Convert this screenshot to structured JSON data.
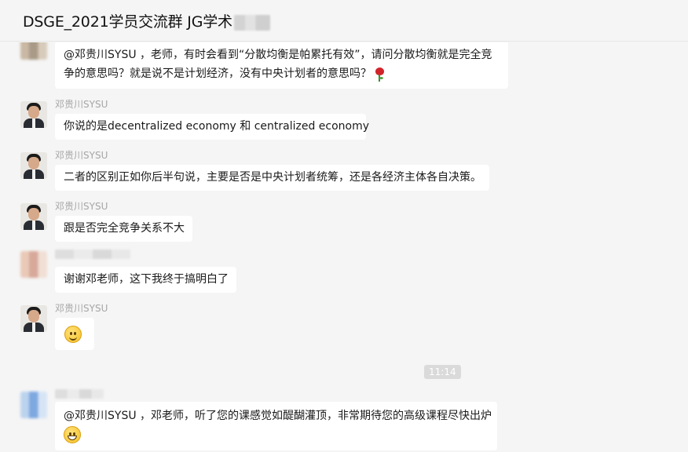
{
  "window": {
    "title": "DSGE_2021学员交流群 JG学术"
  },
  "messages": [
    {
      "sender": "",
      "lines": [
        "@邓贵川SYSU ，老师，有时会看到“分散均衡是帕累托有效”，请问分散均衡就是完全竞",
        "争的意思吗？就是说不是计划经济，没有中央计划者的意思吗？"
      ],
      "emoji": "rose-icon"
    },
    {
      "sender": "邓贵川SYSU",
      "lines": [
        "你说的是decentralized economy 和 centralized economy"
      ]
    },
    {
      "sender": "邓贵川SYSU",
      "lines": [
        "二者的区别正如你后半句说，主要是否是中央计划者统筹，还是各经济主体各自决策。"
      ]
    },
    {
      "sender": "邓贵川SYSU",
      "lines": [
        "跟是否完全竞争关系不大"
      ]
    },
    {
      "sender": "",
      "lines": [
        "谢谢邓老师，这下我终于搞明白了"
      ]
    },
    {
      "sender": "邓贵川SYSU",
      "lines": [],
      "emoji": "smile-emoji-icon"
    },
    {
      "sender": "",
      "lines": [
        "@邓贵川SYSU ，邓老师，听了您的课感觉如醍醐灌顶，非常期待您的高级课程尽快出炉"
      ],
      "emoji": "grin-emoji-icon"
    }
  ],
  "timestamp": "11:14"
}
